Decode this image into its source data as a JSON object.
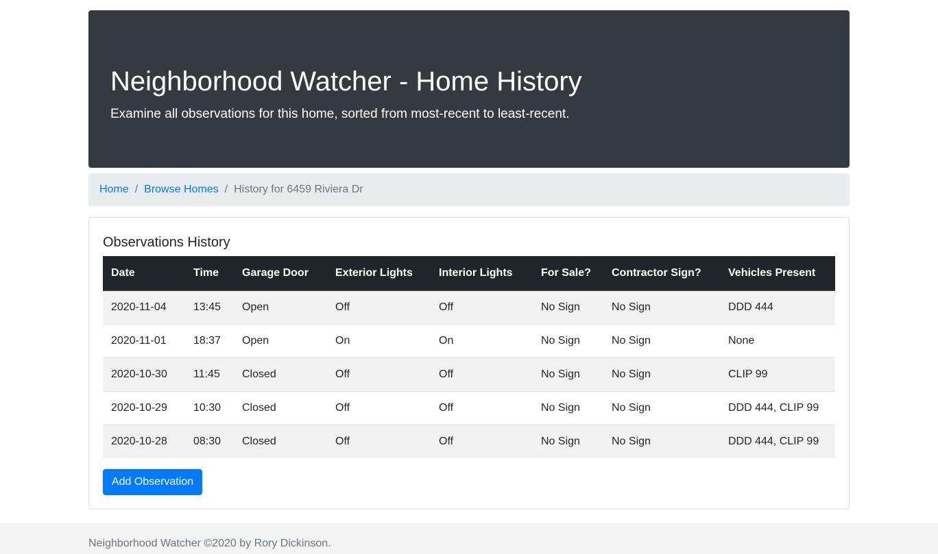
{
  "jumbotron": {
    "title": "Neighborhood Watcher - Home History",
    "subtitle": "Examine all observations for this home, sorted from most-recent to least-recent."
  },
  "breadcrumb": {
    "items": [
      "Home",
      "Browse Homes"
    ],
    "separator": "/",
    "active": "History for 6459 Riviera Dr"
  },
  "card": {
    "title": "Observations History",
    "add_button": "Add Observation"
  },
  "table": {
    "headers": [
      "Date",
      "Time",
      "Garage Door",
      "Exterior Lights",
      "Interior Lights",
      "For Sale?",
      "Contractor Sign?",
      "Vehicles Present"
    ],
    "rows": [
      [
        "2020-11-04",
        "13:45",
        "Open",
        "Off",
        "Off",
        "No Sign",
        "No Sign",
        "DDD 444"
      ],
      [
        "2020-11-01",
        "18:37",
        "Open",
        "On",
        "On",
        "No Sign",
        "No Sign",
        "None"
      ],
      [
        "2020-10-30",
        "11:45",
        "Closed",
        "Off",
        "Off",
        "No Sign",
        "No Sign",
        "CLIP 99"
      ],
      [
        "2020-10-29",
        "10:30",
        "Closed",
        "Off",
        "Off",
        "No Sign",
        "No Sign",
        "DDD 444, CLIP 99"
      ],
      [
        "2020-10-28",
        "08:30",
        "Closed",
        "Off",
        "Off",
        "No Sign",
        "No Sign",
        "DDD 444, CLIP 99"
      ]
    ]
  },
  "footer": {
    "text": "Neighborhood Watcher ©2020 by Rory Dickinson."
  },
  "colors": {
    "jumbotron_bg": "#343a40",
    "primary": "#007bff",
    "table_header_bg": "#212529"
  }
}
